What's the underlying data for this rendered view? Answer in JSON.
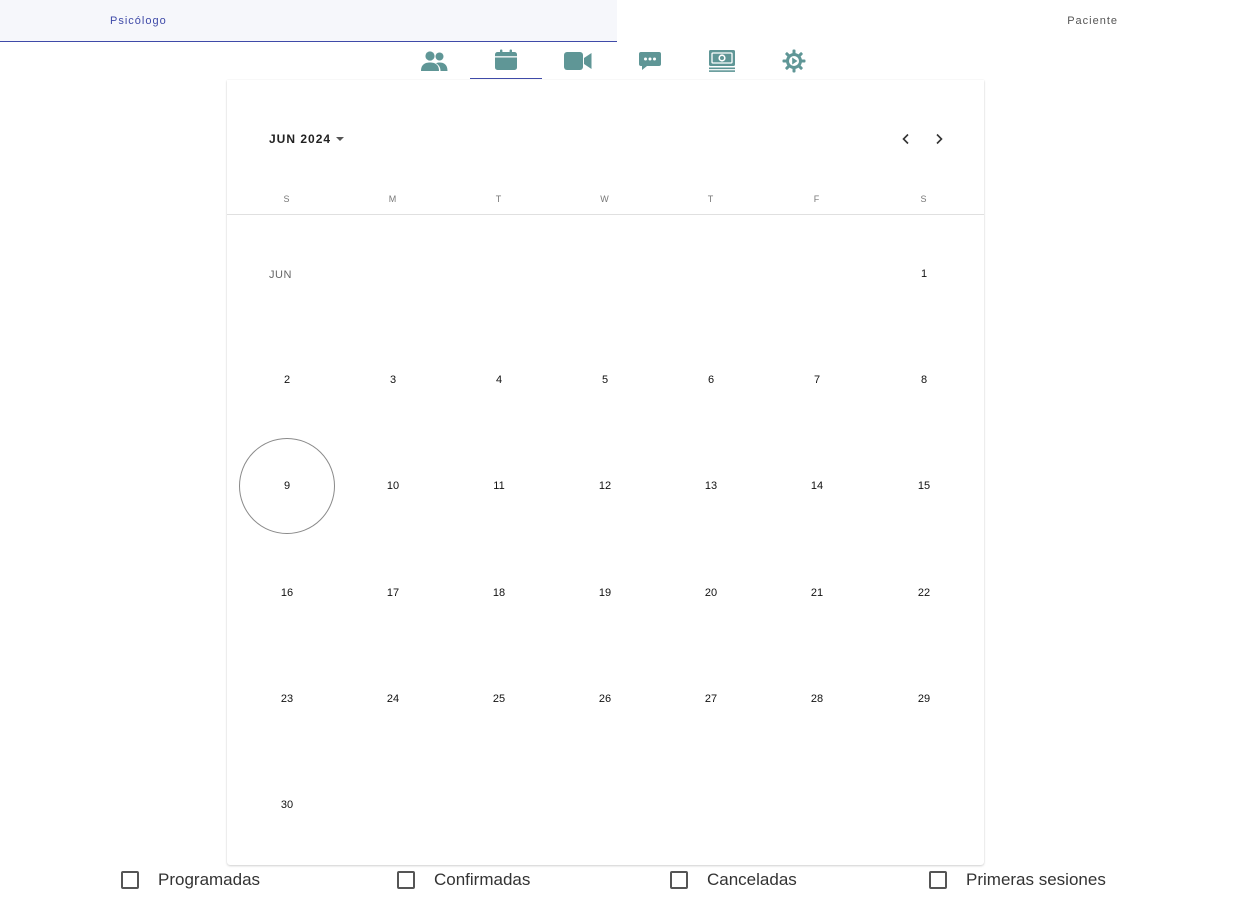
{
  "role_tabs": {
    "psicologo": "Psicólogo",
    "paciente": "Paciente"
  },
  "icon_nav": {
    "items": [
      {
        "icon": "people-icon"
      },
      {
        "icon": "calendar-icon",
        "active": true
      },
      {
        "icon": "video-camera-icon"
      },
      {
        "icon": "chat-icon"
      },
      {
        "icon": "money-icon"
      },
      {
        "icon": "settings-icon"
      }
    ],
    "icon_color": "#5f9696",
    "active_underline_color": "#3f4aa8"
  },
  "calendar": {
    "month_label": "JUN 2024",
    "weekdays": [
      "S",
      "M",
      "T",
      "W",
      "T",
      "F",
      "S"
    ],
    "row_month_label": "JUN",
    "today": "9",
    "weeks": [
      [
        "",
        "",
        "",
        "",
        "",
        "",
        "1"
      ],
      [
        "2",
        "3",
        "4",
        "5",
        "6",
        "7",
        "8"
      ],
      [
        "9",
        "10",
        "11",
        "12",
        "13",
        "14",
        "15"
      ],
      [
        "16",
        "17",
        "18",
        "19",
        "20",
        "21",
        "22"
      ],
      [
        "23",
        "24",
        "25",
        "26",
        "27",
        "28",
        "29"
      ],
      [
        "30",
        "",
        "",
        "",
        "",
        "",
        ""
      ]
    ]
  },
  "legend": {
    "programadas": "Programadas",
    "confirmadas": "Confirmadas",
    "canceladas": "Canceladas",
    "primeras": "Primeras sesiones"
  }
}
